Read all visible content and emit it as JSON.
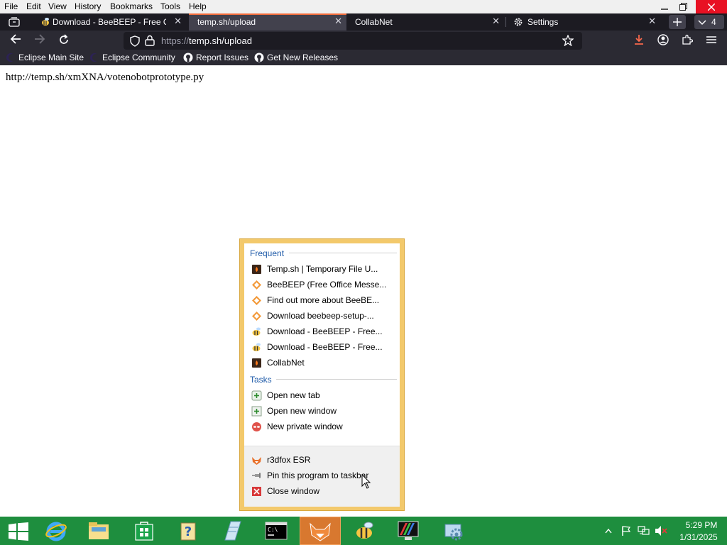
{
  "menubar": {
    "items": [
      "File",
      "Edit",
      "View",
      "History",
      "Bookmarks",
      "Tools",
      "Help"
    ]
  },
  "tabs": [
    {
      "label": "Download - BeeBEEP - Free Off",
      "icon": "bee-icon",
      "active": false
    },
    {
      "label": "temp.sh/upload",
      "icon": "",
      "active": true
    },
    {
      "label": "CollabNet",
      "icon": "",
      "active": false
    },
    {
      "label": "Settings",
      "icon": "gear-icon",
      "active": false
    }
  ],
  "tab_count": "4",
  "address": {
    "scheme": "https://",
    "host_path": "temp.sh/upload"
  },
  "bookmarks": [
    {
      "label": "Eclipse Main Site",
      "icon": "eclipse-icon"
    },
    {
      "label": "Eclipse Community",
      "icon": "eclipse-icon"
    },
    {
      "label": "Report Issues",
      "icon": "github-icon"
    },
    {
      "label": "Get New Releases",
      "icon": "github-icon"
    }
  ],
  "page": {
    "text": "http://temp.sh/xmXNA/votenobotprototype.py"
  },
  "jumplist": {
    "frequent_header": "Frequent",
    "frequent": [
      {
        "label": "Temp.sh | Temporary File U...",
        "icon": "tempsh-icon"
      },
      {
        "label": "BeeBEEP (Free Office Messe...",
        "icon": "beebeep-icon"
      },
      {
        "label": "Find out more about BeeBE...",
        "icon": "beebeep-icon"
      },
      {
        "label": "Download beebeep-setup-...",
        "icon": "beebeep-icon"
      },
      {
        "label": "Download - BeeBEEP - Free...",
        "icon": "bee-icon"
      },
      {
        "label": "Download - BeeBEEP - Free...",
        "icon": "bee-icon"
      },
      {
        "label": "CollabNet",
        "icon": "tempsh-icon"
      }
    ],
    "tasks_header": "Tasks",
    "tasks": [
      {
        "label": "Open new tab",
        "icon": "new-tab-icon"
      },
      {
        "label": "Open new window",
        "icon": "new-window-icon"
      },
      {
        "label": "New private window",
        "icon": "private-window-icon"
      }
    ],
    "bottom": [
      {
        "label": "r3dfox ESR",
        "icon": "r3dfox-icon"
      },
      {
        "label": "Pin this program to taskbar",
        "icon": "pin-icon"
      },
      {
        "label": "Close window",
        "icon": "close-window-icon"
      }
    ]
  },
  "taskbar": {
    "clock_time": "5:29 PM",
    "clock_date": "1/31/2025"
  },
  "colors": {
    "taskbar": "#1e8e3e",
    "tab_active_accent": "#f26b3a",
    "jumplist_frame": "#f3c96b"
  }
}
